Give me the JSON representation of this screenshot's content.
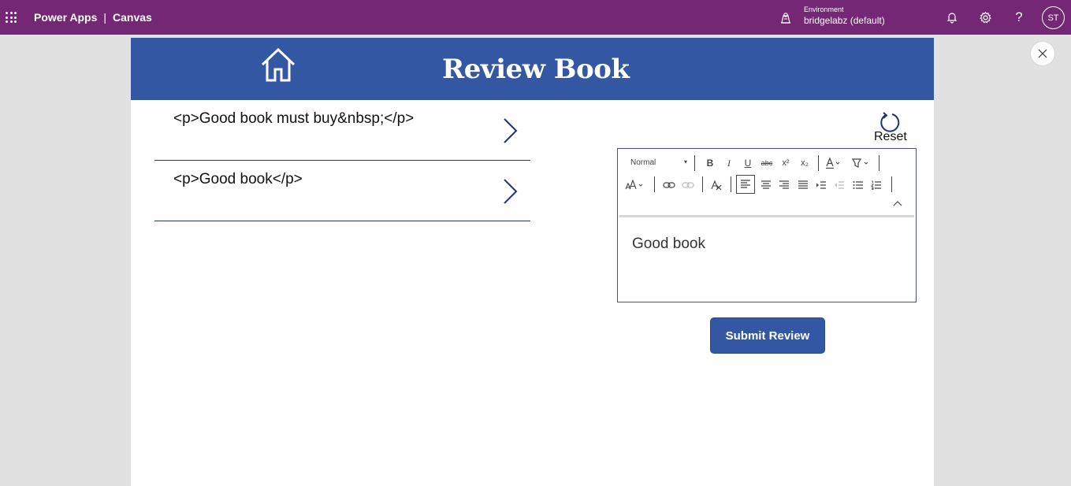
{
  "topbar": {
    "app_name": "Power Apps",
    "separator": "|",
    "section": "Canvas",
    "environment_label": "Environment",
    "environment_name": "bridgelabz (default)",
    "avatar_initials": "ST",
    "help_glyph": "?",
    "icons": [
      "app-launcher-icon",
      "environment-icon",
      "bell-icon",
      "gear-icon",
      "help-icon"
    ]
  },
  "app": {
    "title": "Review Book",
    "header_color": "#3357a3",
    "reviews": [
      {
        "text": "<p>Good book must buy&nbsp;</p>"
      },
      {
        "text": "<p>Good book</p>"
      }
    ],
    "reset_label": "Reset",
    "editor": {
      "format_value": "Normal",
      "content": "Good book",
      "tool_labels": {
        "bold": "B",
        "italic": "I",
        "underline": "U",
        "strikethrough": "abc",
        "superscript": "x²",
        "subscript": "x₂"
      }
    },
    "submit_label": "Submit Review"
  },
  "colors": {
    "topbar": "#742774",
    "accent": "#3357a3",
    "page_bg": "#e1e1e1"
  }
}
